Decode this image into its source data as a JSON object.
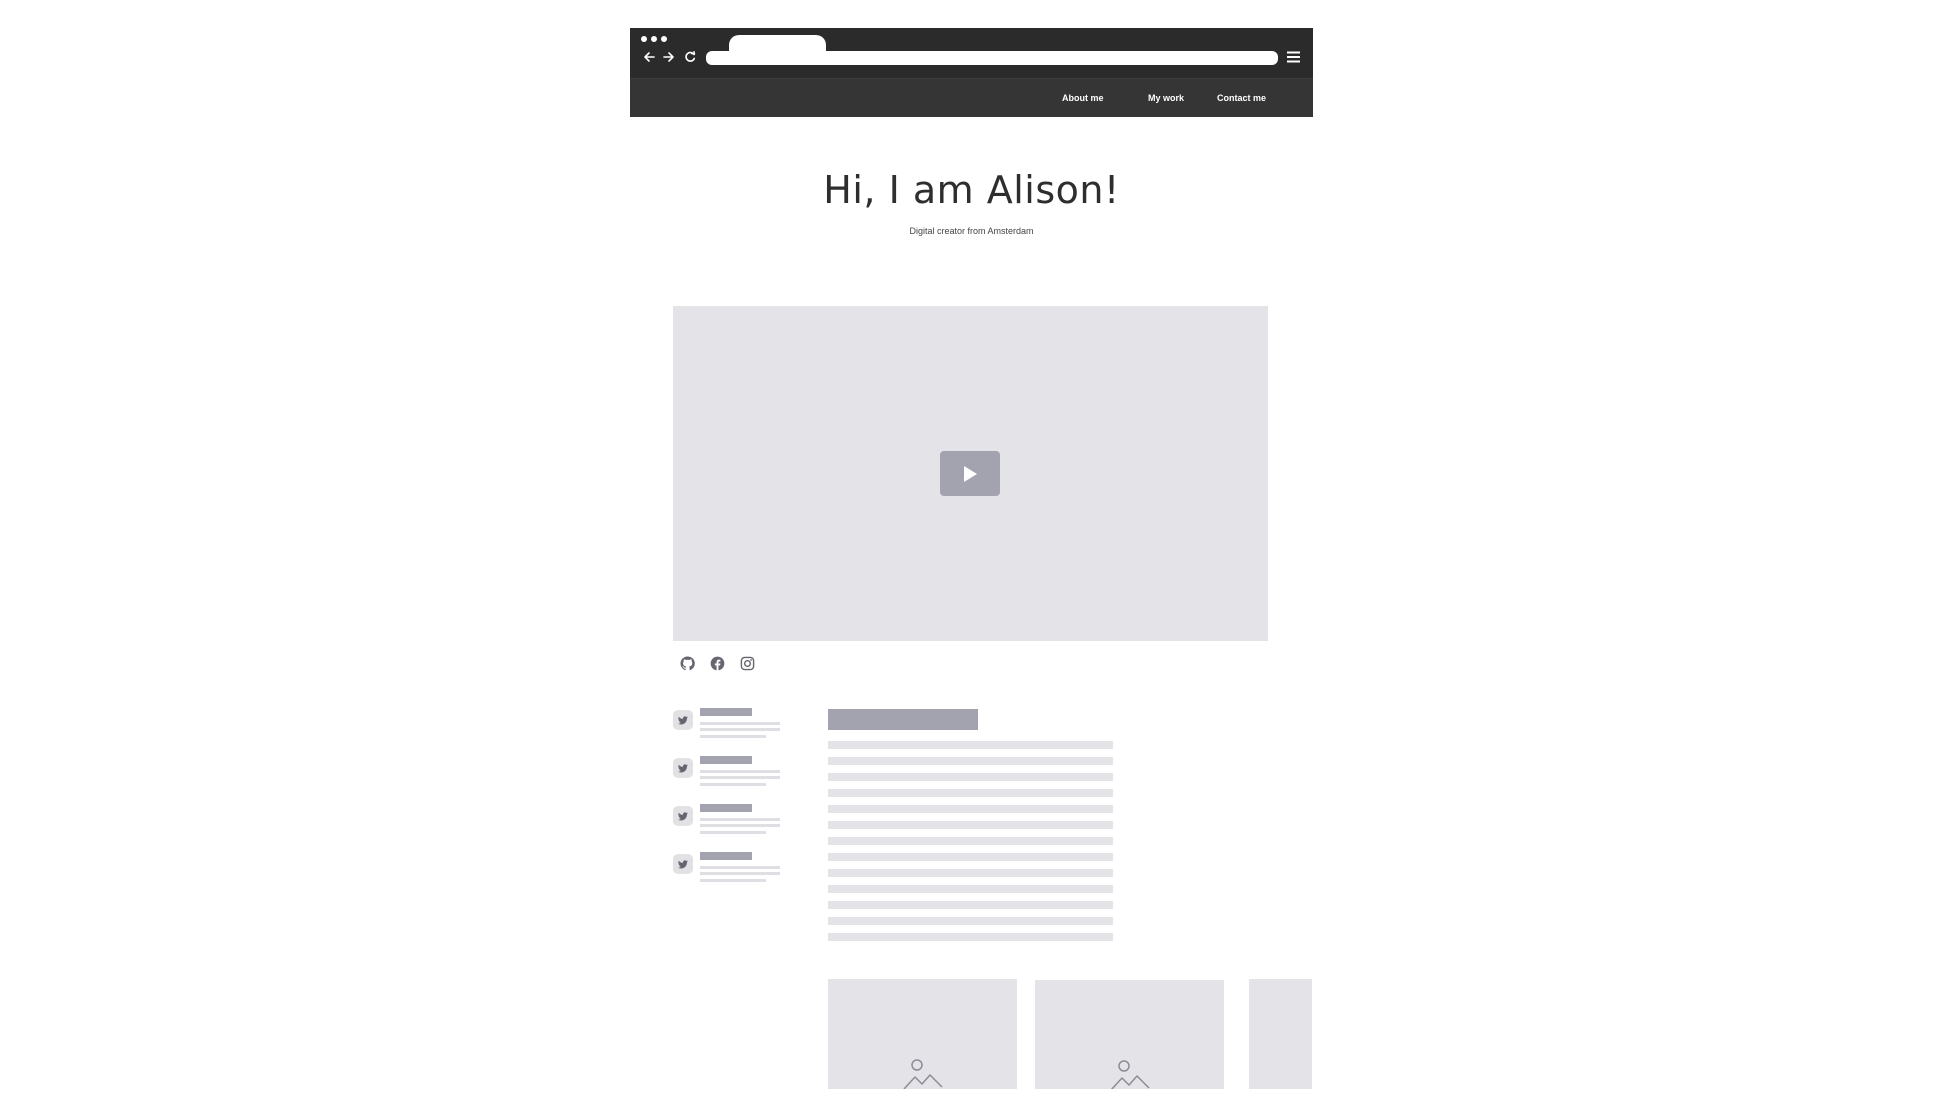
{
  "browser": {
    "tab_title": "",
    "address": "",
    "icons": {
      "back": "arrow-left-icon",
      "forward": "arrow-right-icon",
      "reload": "reload-icon",
      "menu": "hamburger-menu-icon"
    }
  },
  "nav": {
    "items": [
      {
        "label": "About me"
      },
      {
        "label": "My work"
      },
      {
        "label": "Contact me"
      }
    ]
  },
  "hero": {
    "title": "Hi, I am Alison!",
    "subtitle": "Digital creator from Amsterdam"
  },
  "video": {
    "icon": "play-icon"
  },
  "social": {
    "icons": [
      "github-icon",
      "facebook-icon",
      "instagram-icon"
    ]
  },
  "tweets": {
    "icon": "twitter-icon",
    "count_placeholder": 4
  },
  "gallery": {
    "icon": "image-placeholder-icon"
  },
  "colors": {
    "chrome_bg": "#2b2b2b",
    "nav_bg": "#353535",
    "placeholder_light": "#e4e4e8",
    "placeholder_dark": "#a3a3b0",
    "text_dark": "#2e2e2e"
  }
}
